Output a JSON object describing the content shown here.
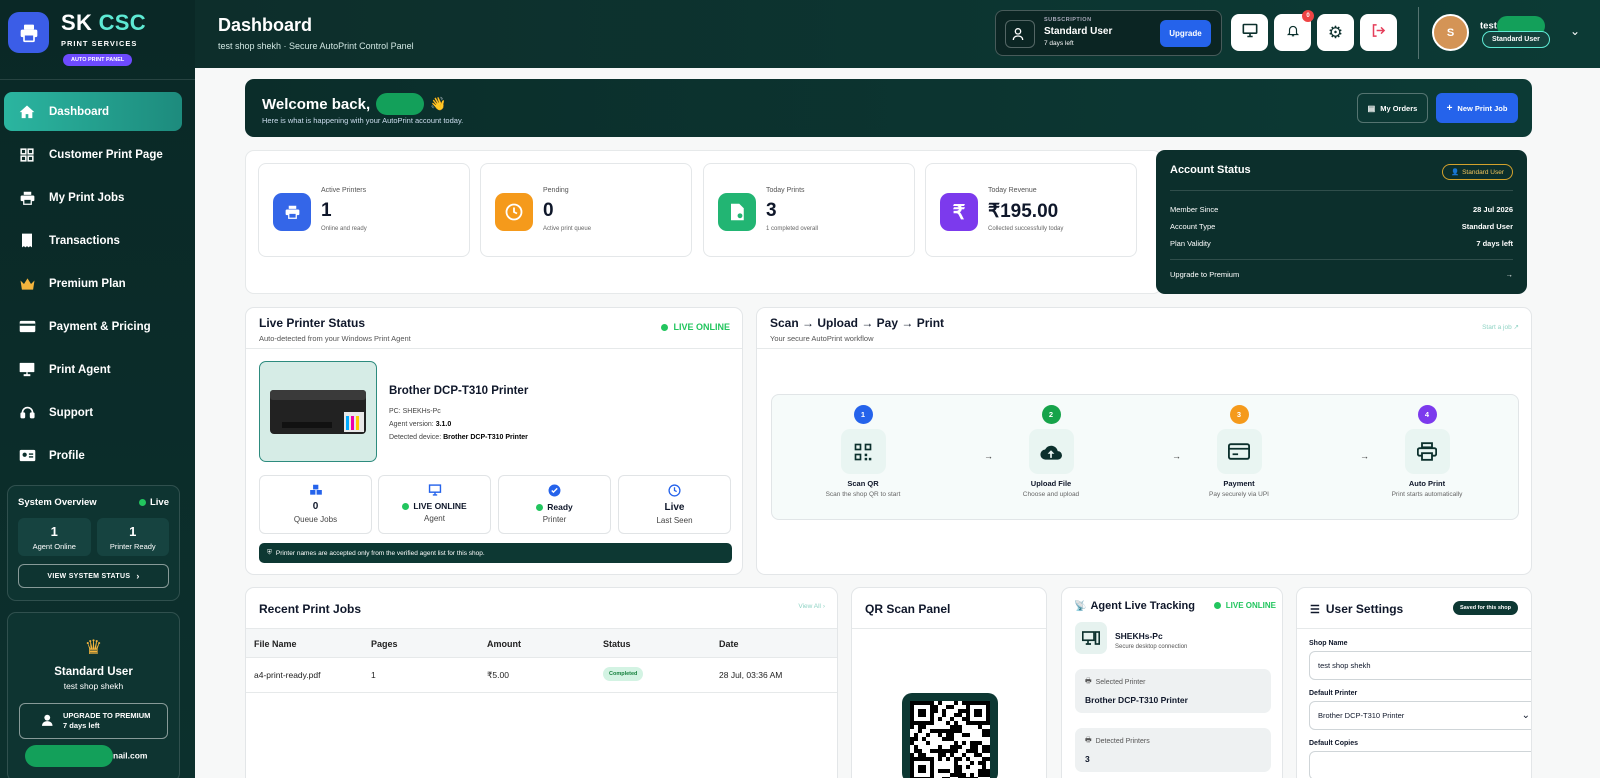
{
  "brand": {
    "name_a": "SK ",
    "name_b": "CSC",
    "subtitle": "PRINT SERVICES",
    "pill": "AUTO PRINT PANEL"
  },
  "nav": [
    {
      "label": "Dashboard",
      "icon": "home-icon",
      "active": true
    },
    {
      "label": "Customer Print Page",
      "icon": "grid-icon"
    },
    {
      "label": "My Print Jobs",
      "icon": "printer-icon"
    },
    {
      "label": "Transactions",
      "icon": "receipt-icon"
    },
    {
      "label": "Premium Plan",
      "icon": "crown-icon"
    },
    {
      "label": "Payment & Pricing",
      "icon": "credit-card-icon"
    },
    {
      "label": "Print Agent",
      "icon": "monitor-icon"
    },
    {
      "label": "Support",
      "icon": "headset-icon"
    },
    {
      "label": "Profile",
      "icon": "id-card-icon"
    }
  ],
  "overview": {
    "title": "System Overview",
    "live": "Live",
    "agent_count": "1",
    "agent_label": "Agent Online",
    "printer_count": "1",
    "printer_label": "Printer Ready",
    "button": "VIEW SYSTEM STATUS"
  },
  "plan": {
    "name": "Standard User",
    "shop": "test shop shekh",
    "button_line1": "UPGRADE TO PREMIUM",
    "button_line2": "7 days left",
    "email_tail": "nail.com"
  },
  "header": {
    "title": "Dashboard",
    "subtitle": "test shop shekh · Secure AutoPrint Control Panel",
    "notifications": "0",
    "subscription": {
      "label": "SUBSCRIPTION",
      "plan": "Standard User",
      "days": "7 days left",
      "upgrade": "Upgrade"
    },
    "avatar_letter": "S",
    "user_name": "test s",
    "user_role": "Standard User"
  },
  "welcome": {
    "title": "Welcome back,",
    "emoji": "👋",
    "subtitle": "Here is what is happening with your AutoPrint account today.",
    "orders_btn": "My Orders",
    "new_btn": "New Print Job"
  },
  "stats": [
    {
      "label": "Active Printers",
      "value": "1",
      "note": "Online and ready",
      "color": "#3466e8",
      "icon": "printer-icon"
    },
    {
      "label": "Pending",
      "value": "0",
      "note": "Active print queue",
      "color": "#f59a1b",
      "icon": "clock-icon"
    },
    {
      "label": "Today Prints",
      "value": "3",
      "note": "1 completed overall",
      "color": "#22b573",
      "icon": "file-check-icon"
    },
    {
      "label": "Today Revenue",
      "value": "₹195.00",
      "note": "Collected successfully today",
      "color": "#7c3aed",
      "icon": "rupee-icon"
    }
  ],
  "account": {
    "title": "Account Status",
    "badge": "Standard User",
    "rows": [
      {
        "k": "Member Since",
        "v": "28 Jul 2026"
      },
      {
        "k": "Account Type",
        "v": "Standard User"
      },
      {
        "k": "Plan Validity",
        "v": "7 days left"
      }
    ],
    "upgrade": "Upgrade to Premium",
    "arrow": "→"
  },
  "printer": {
    "title": "Live Printer Status",
    "subtitle": "Auto-detected from your Windows Print Agent",
    "live": "LIVE ONLINE",
    "name": "Brother DCP-T310 Printer",
    "pc_label": "PC:",
    "pc": "SHEKHs-Pc",
    "agent_label": "Agent version:",
    "agent": "3.1.0",
    "device_label": "Detected device:",
    "device": "Brother DCP-T310 Printer",
    "tiles": [
      {
        "value": "0",
        "label": "Queue Jobs"
      },
      {
        "value": "LIVE ONLINE",
        "label": "Agent"
      },
      {
        "value": "Ready",
        "label": "Printer"
      },
      {
        "value": "Live",
        "label": "Last Seen"
      }
    ],
    "notice": "Printer names are accepted only from the verified agent list for this shop."
  },
  "flow": {
    "title": "Scan → Upload → Pay → Print",
    "subtitle": "Your secure AutoPrint workflow",
    "link": "Start a job",
    "steps": [
      {
        "n": "1",
        "title": "Scan QR",
        "desc": "Scan the shop QR to start",
        "color": "#2563eb",
        "icon": "qr-icon"
      },
      {
        "n": "2",
        "title": "Upload File",
        "desc": "Choose and upload",
        "color": "#16a34a",
        "icon": "cloud-upload-icon"
      },
      {
        "n": "3",
        "title": "Payment",
        "desc": "Pay securely via UPI",
        "color": "#f59a1b",
        "icon": "card-icon"
      },
      {
        "n": "4",
        "title": "Auto Print",
        "desc": "Print starts automatically",
        "color": "#7c3aed",
        "icon": "printer-icon"
      }
    ],
    "arrow": "→"
  },
  "jobs": {
    "title": "Recent Print Jobs",
    "view_all": "View All",
    "headers": [
      "File Name",
      "Pages",
      "Amount",
      "Status",
      "Date"
    ],
    "rows": [
      {
        "file": "a4-print-ready.pdf",
        "pages": "1",
        "amount": "₹5.00",
        "status": "Completed",
        "date": "28 Jul, 03:36 AM"
      }
    ]
  },
  "qr": {
    "title": "QR Scan Panel"
  },
  "tracking": {
    "title": "Agent Live Tracking",
    "live": "LIVE ONLINE",
    "device": "SHEKHs-Pc",
    "device_sub": "Secure desktop connection",
    "selected_label": "Selected Printer",
    "selected": "Brother DCP-T310 Printer",
    "detected_label": "Detected Printers",
    "detected": "3"
  },
  "settings": {
    "title": "User Settings",
    "badge": "Saved for this shop",
    "shop_label": "Shop Name",
    "shop_value": "test shop shekh",
    "printer_label": "Default Printer",
    "printer_value": "Brother DCP-T310 Printer",
    "copies_label": "Default Copies"
  }
}
